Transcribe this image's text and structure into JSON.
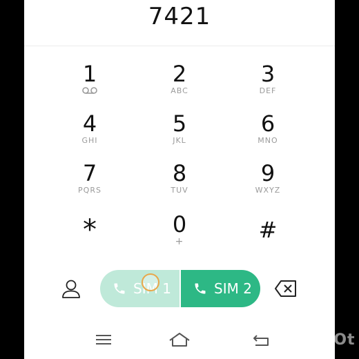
{
  "dialer": {
    "number": "7421",
    "keys": [
      {
        "digit": "1",
        "letters": ""
      },
      {
        "digit": "2",
        "letters": "ABC"
      },
      {
        "digit": "3",
        "letters": "DEF"
      },
      {
        "digit": "4",
        "letters": "GHI"
      },
      {
        "digit": "5",
        "letters": "JKL"
      },
      {
        "digit": "6",
        "letters": "MNO"
      },
      {
        "digit": "7",
        "letters": "PQRS"
      },
      {
        "digit": "8",
        "letters": "TUV"
      },
      {
        "digit": "9",
        "letters": "WXYZ"
      },
      {
        "digit": "*",
        "letters": ""
      },
      {
        "digit": "0",
        "letters": "+"
      },
      {
        "digit": "#",
        "letters": ""
      }
    ],
    "key1_icon": "voicemail-icon"
  },
  "actions": {
    "contact_icon": "person-icon",
    "sim1_label": "SIM 1",
    "sim2_label": "SIM 2",
    "call_icon": "phone-icon",
    "backspace_icon": "backspace-icon"
  },
  "navbar": {
    "menu_icon": "menu-icon",
    "home_icon": "home-icon",
    "back_icon": "back-icon"
  },
  "watermark": "InShOt",
  "colors": {
    "sim1_bg": "#bfe9d9",
    "sim2_bg": "#2db885",
    "text": "#111111",
    "letters": "#9a9a9a"
  }
}
